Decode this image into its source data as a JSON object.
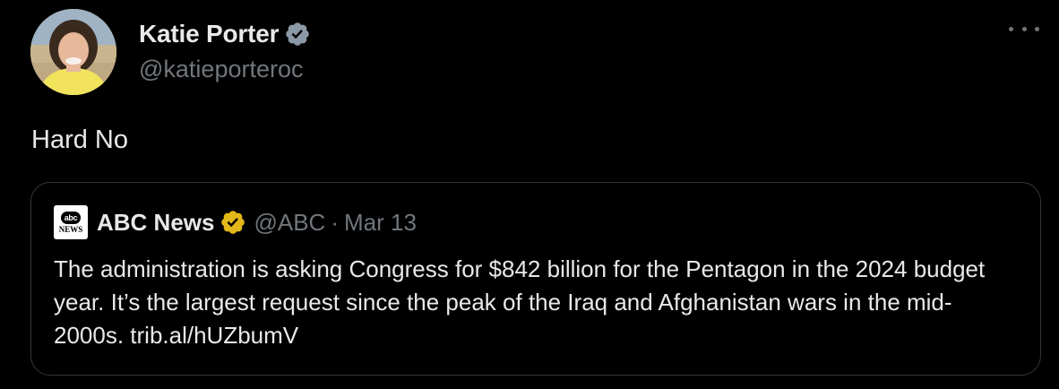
{
  "author": {
    "display_name": "Katie Porter",
    "handle": "@katieporteroc",
    "verified_badge_color": "#8b98a5"
  },
  "menu": {
    "icon": "more-horizontal-icon"
  },
  "tweet": {
    "text": "Hard No"
  },
  "quoted_tweet": {
    "source_name": "ABC News",
    "handle": "@ABC",
    "separator": "·",
    "date": "Mar 13",
    "logo_text": "abc",
    "logo_caption": "NEWS",
    "verified_badge_color": "#e2b719",
    "text": "The administration is asking Congress for $842 billion for the Pentagon in the 2024 budget year. It’s the largest request since the peak of the Iraq and Afghanistan wars in the mid-2000s. trib.al/hUZbumV"
  },
  "colors": {
    "background": "#000000",
    "primary_text": "#e7e9ea",
    "secondary_text": "#71767b",
    "border": "#333639"
  }
}
